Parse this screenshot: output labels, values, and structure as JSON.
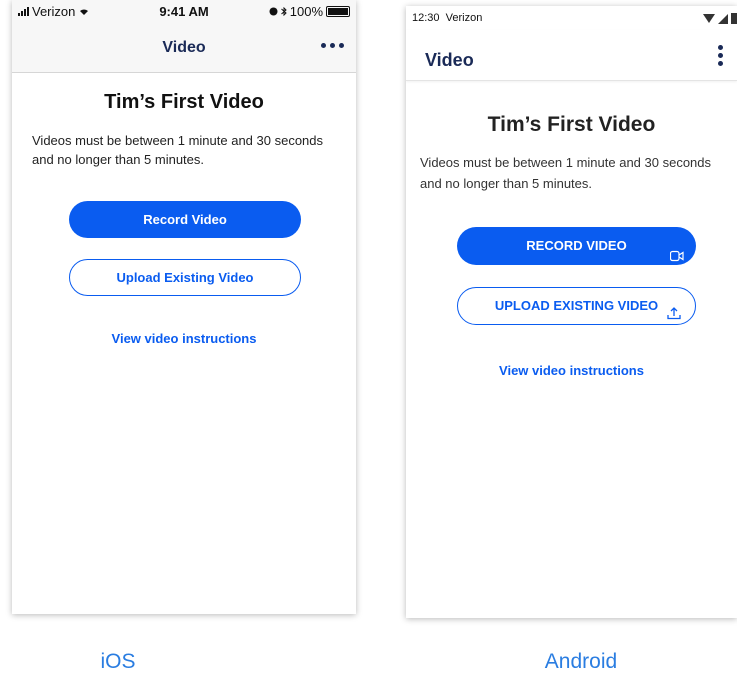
{
  "ios": {
    "status": {
      "carrier": "Verizon",
      "time": "9:41 AM",
      "battery": "100%"
    },
    "nav_title": "Video",
    "title": "Tim’s First Video",
    "description": "Videos must be between 1 minute and 30 seconds and no longer than 5 minutes.",
    "record_label": "Record Video",
    "upload_label": "Upload Existing Video",
    "instructions_link": "View video instructions",
    "caption": "iOS"
  },
  "android": {
    "status": {
      "time": "12:30",
      "carrier": "Verizon"
    },
    "nav_title": "Video",
    "title": "Tim’s First Video",
    "description": "Videos must be between 1 minute and 30 seconds and no longer than 5 minutes.",
    "record_label": "RECORD VIDEO",
    "upload_label": "UPLOAD EXISTING VIDEO",
    "instructions_link": "View video instructions",
    "caption": "Android"
  },
  "colors": {
    "accent": "#0a5cf0",
    "navy": "#1a2a57",
    "caption": "#2a7de1"
  },
  "icons": [
    "wifi-icon",
    "signal-icon",
    "battery-icon",
    "more-horizontal-icon",
    "more-vertical-icon",
    "video-camera-icon",
    "upload-icon",
    "alarm-icon",
    "bluetooth-icon"
  ]
}
